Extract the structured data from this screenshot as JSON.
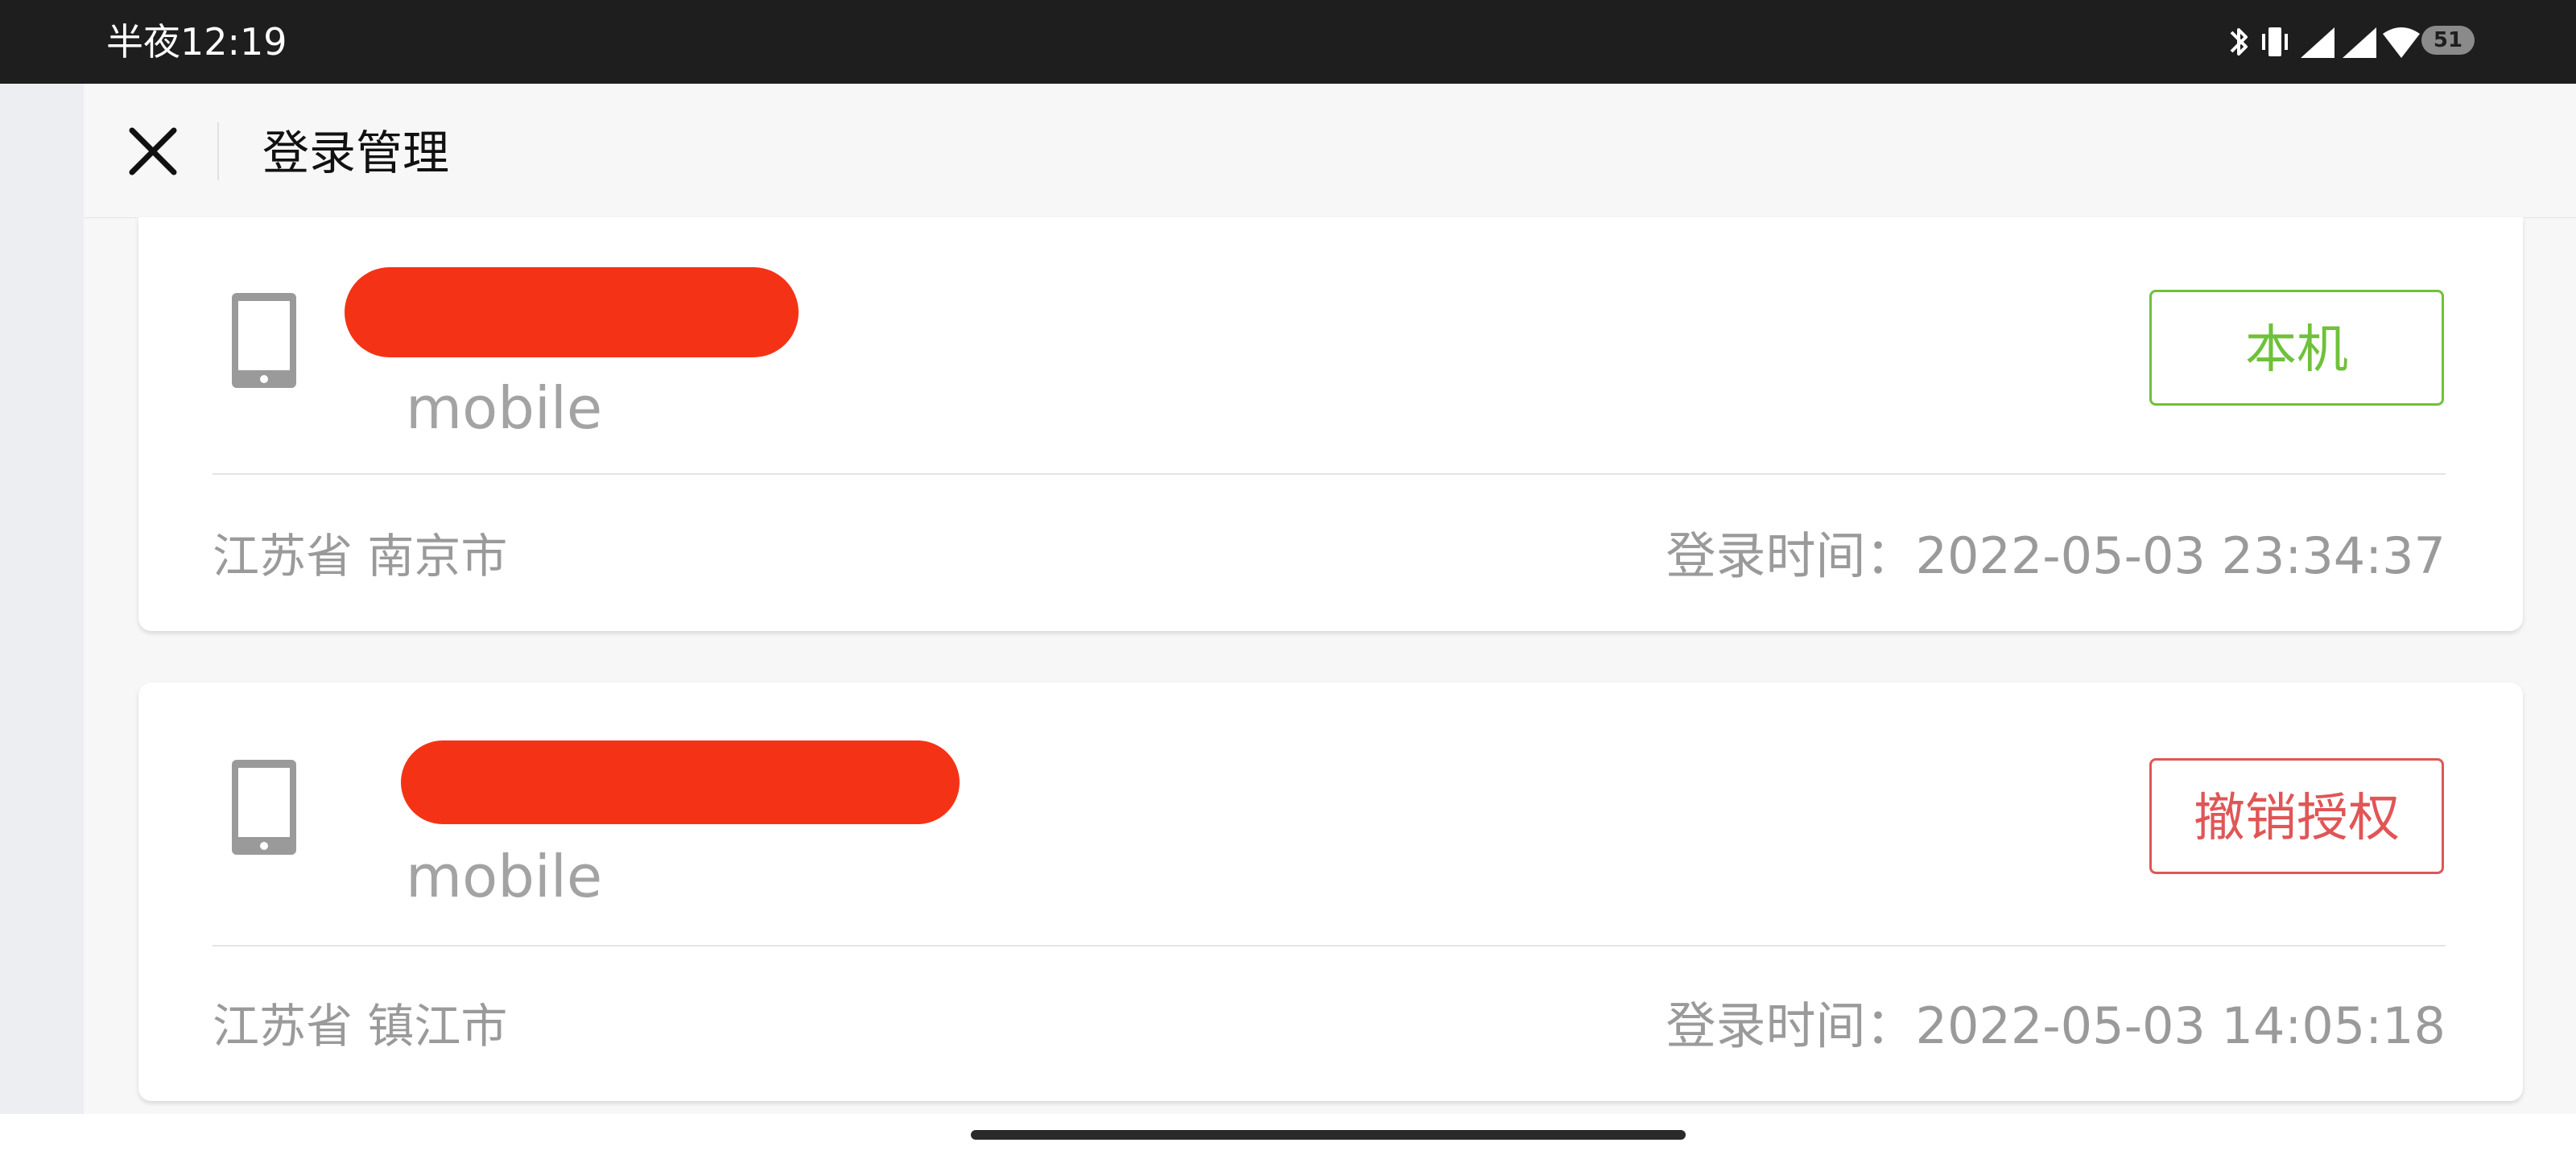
{
  "status_bar": {
    "time": "半夜12:19",
    "battery_level": "51",
    "icons": [
      "bluetooth-icon",
      "vibrate-icon",
      "signal-icon",
      "signal-icon",
      "wifi-icon",
      "battery-icon"
    ]
  },
  "header": {
    "close_icon": "close-icon",
    "title": "登录管理"
  },
  "sessions": [
    {
      "icon": "phone-icon",
      "device_name": "",
      "device_type": "mobile",
      "action_label": "本机",
      "location": "江苏省 南京市",
      "login_time": "登录时间：2022-05-03 23:34:37"
    },
    {
      "icon": "phone-icon",
      "device_name": "",
      "device_type": "mobile",
      "action_label": "撤销授权",
      "location": "江苏省 镇江市",
      "login_time": "登录时间：2022-05-03 14:05:18"
    }
  ],
  "colors": {
    "current_device": "#6fc13a",
    "revoke": "#e05656",
    "redaction": "#f43316"
  }
}
